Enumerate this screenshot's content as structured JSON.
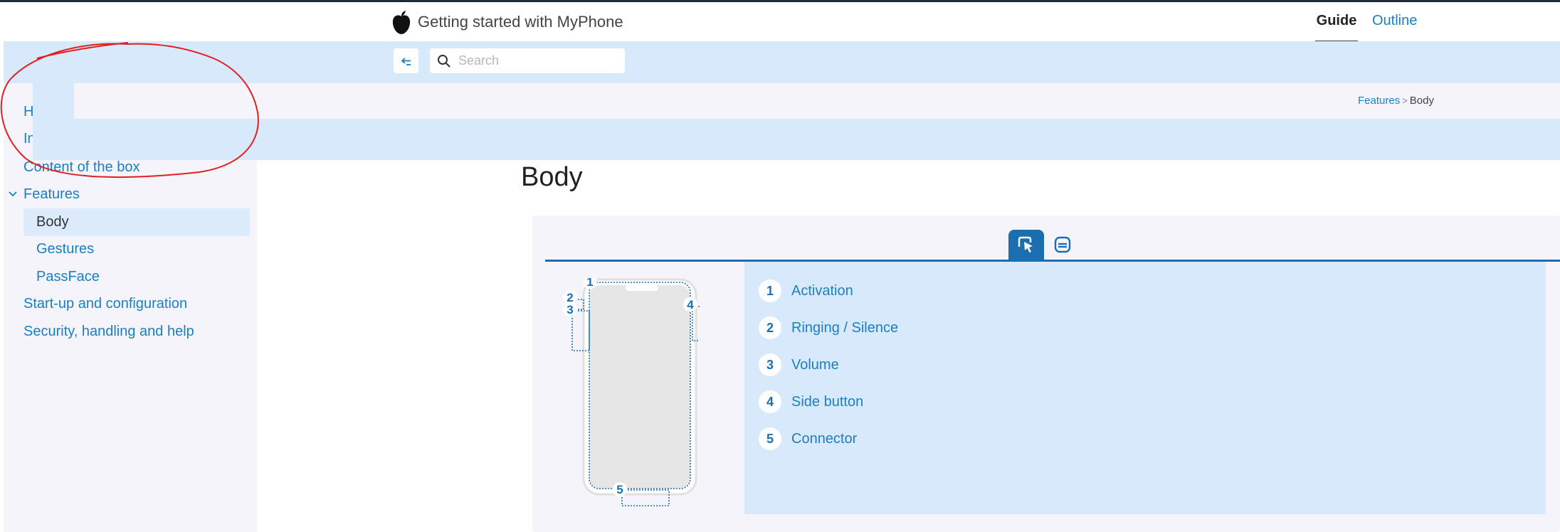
{
  "header": {
    "app_title": "Getting started with MyPhone",
    "tabs": [
      {
        "label": "Guide"
      },
      {
        "label": "Outline"
      }
    ]
  },
  "search": {
    "placeholder": "Search"
  },
  "sidebar": {
    "items": [
      {
        "label": "H"
      },
      {
        "label": "In"
      },
      {
        "label": "Content of the box"
      },
      {
        "label": "Features"
      },
      {
        "label": "Body"
      },
      {
        "label": "Gestures"
      },
      {
        "label": "PassFace"
      },
      {
        "label": "Start-up and configuration"
      },
      {
        "label": "Security, handling and help"
      }
    ]
  },
  "breadcrumb": {
    "parent": "Features",
    "separator": ">",
    "current": "Body"
  },
  "page": {
    "title": "Body"
  },
  "legend": [
    {
      "num": "1",
      "label": "Activation"
    },
    {
      "num": "2",
      "label": "Ringing / Silence"
    },
    {
      "num": "3",
      "label": "Volume"
    },
    {
      "num": "4",
      "label": "Side button"
    },
    {
      "num": "5",
      "label": "Connector"
    }
  ],
  "diagram_labels": [
    "1",
    "2",
    "3",
    "4",
    "5"
  ],
  "colors": {
    "accent": "#1b7fc0",
    "accent_dark": "#1b6fb0",
    "band": "#d8e9fc",
    "sidebar_bg": "#f4f4fa",
    "annotation": "#e02020"
  },
  "icons": {
    "logo": "apple-logo-icon",
    "collapse": "collapse-sidebar-icon",
    "search": "search-icon",
    "chevron": "chevron-down-icon",
    "view_diagram": "touch-pointer-icon",
    "view_list": "list-card-icon"
  }
}
